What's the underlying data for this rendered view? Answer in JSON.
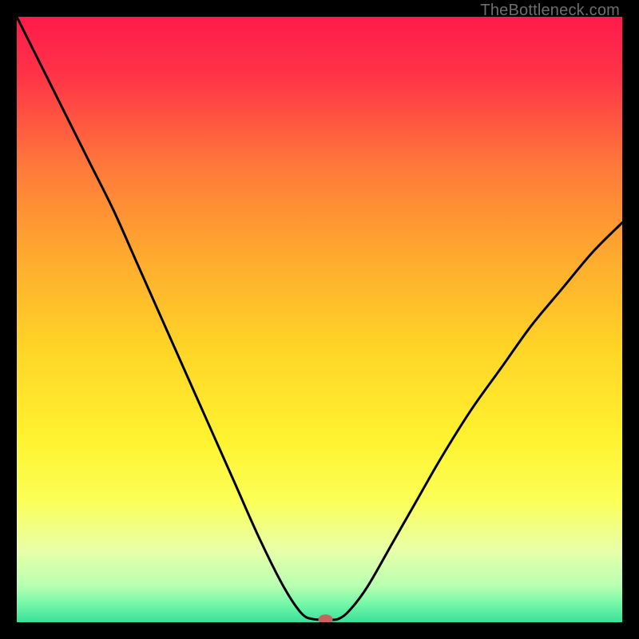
{
  "watermark": "TheBottleneck.com",
  "chart_data": {
    "type": "line",
    "title": "",
    "xlabel": "",
    "ylabel": "",
    "xlim": [
      0,
      100
    ],
    "ylim": [
      0,
      100
    ],
    "grid": false,
    "legend": false,
    "background_gradient": {
      "stops": [
        {
          "offset": 0.0,
          "color": "#ff1a4b"
        },
        {
          "offset": 0.1,
          "color": "#ff3547"
        },
        {
          "offset": 0.25,
          "color": "#ff7a3a"
        },
        {
          "offset": 0.4,
          "color": "#ffab2e"
        },
        {
          "offset": 0.55,
          "color": "#ffd527"
        },
        {
          "offset": 0.7,
          "color": "#fff330"
        },
        {
          "offset": 0.8,
          "color": "#fbff57"
        },
        {
          "offset": 0.88,
          "color": "#e9ffa8"
        },
        {
          "offset": 0.94,
          "color": "#b8ffb1"
        },
        {
          "offset": 0.97,
          "color": "#74f7a8"
        },
        {
          "offset": 1.0,
          "color": "#39e09a"
        }
      ]
    },
    "series": [
      {
        "name": "bottleneck-curve",
        "x": [
          0,
          4,
          8,
          12,
          16,
          20,
          24,
          28,
          32,
          36,
          40,
          44,
          47,
          49,
          51,
          53,
          55,
          58,
          62,
          66,
          70,
          75,
          80,
          85,
          90,
          95,
          100
        ],
        "y": [
          100,
          92,
          84,
          76,
          68,
          59,
          50,
          41,
          32,
          23,
          14,
          6,
          1.5,
          0.5,
          0.5,
          0.5,
          2,
          6,
          13,
          20,
          27,
          35,
          42,
          49,
          55,
          61,
          66
        ]
      }
    ],
    "marker": {
      "x": 51,
      "y": 0.5,
      "color": "#c5645f",
      "rx": 9,
      "ry": 6
    }
  }
}
